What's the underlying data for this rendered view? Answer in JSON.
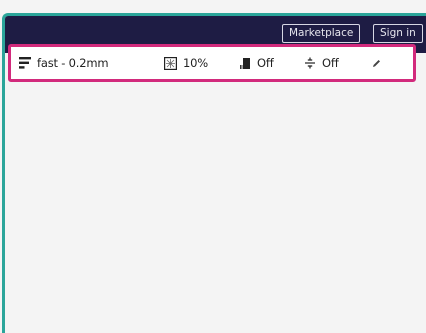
{
  "header": {
    "marketplace_label": "Marketplace",
    "signin_label": "Sign in",
    "background_color": "#1e1c44"
  },
  "print_settings": {
    "profile_label": "fast - 0.2mm",
    "profile_icon": "profile-lines-icon",
    "infill_label": "10%",
    "infill_icon": "infill-icon",
    "support_label": "Off",
    "support_icon": "support-icon",
    "adhesion_label": "Off",
    "adhesion_icon": "adhesion-icon",
    "edit_icon": "pencil-icon",
    "highlight_color": "#d22a7c"
  },
  "accent_color": "#2ba59a"
}
